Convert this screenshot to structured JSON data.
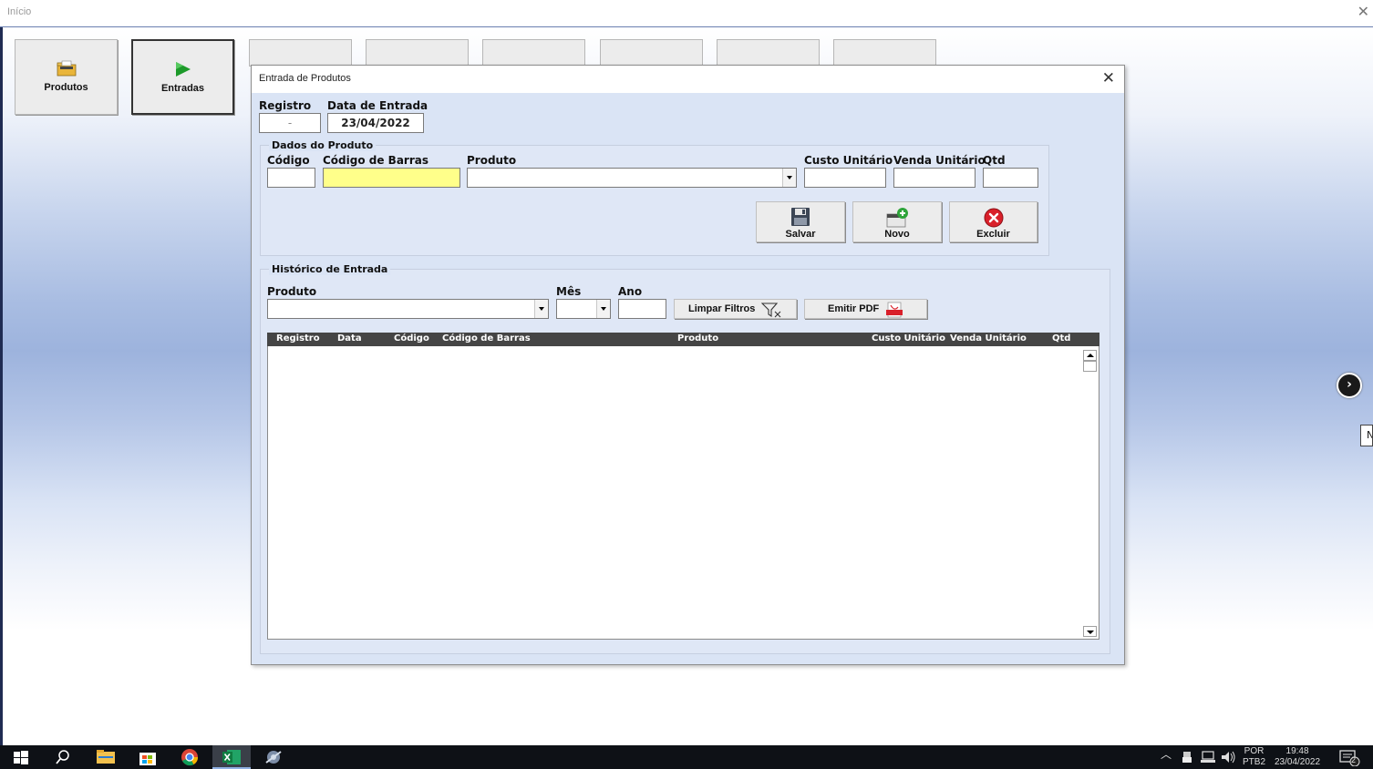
{
  "window": {
    "title": "Início",
    "close": "✕"
  },
  "nav": {
    "produtos": "Produtos",
    "entradas": "Entradas"
  },
  "dialog": {
    "title": "Entrada de Produtos",
    "close": "✕",
    "registro_label": "Registro",
    "registro_value": "-",
    "data_label": "Data de Entrada",
    "data_value": "23/04/2022",
    "dados_caption": "Dados do Produto",
    "codigo_label": "Código",
    "codigo_barras_label": "Código de Barras",
    "produto_label": "Produto",
    "custo_label": "Custo Unitário",
    "venda_label": "Venda Unitário",
    "qtd_label": "Qtd",
    "salvar": "Salvar",
    "novo": "Novo",
    "excluir": "Excluir",
    "historico_caption": "Histórico de Entrada",
    "filtro_produto_label": "Produto",
    "mes_label": "Mês",
    "ano_label": "Ano",
    "limpar": "Limpar Filtros",
    "emitir": "Emitir PDF",
    "columns": [
      "Registro",
      "Data",
      "Código",
      "Código de Barras",
      "Produto",
      "Custo Unitário",
      "Venda Unitário",
      "Qtd"
    ]
  },
  "side": {
    "next": "›",
    "tab": "N"
  },
  "tray": {
    "lang1": "POR",
    "lang2": "PTB2",
    "time": "19:48",
    "date": "23/04/2022",
    "notif": "2"
  },
  "colors": {
    "accent_yellow": "#ffff8a",
    "header_dark": "#454545",
    "dialog_bg": "#dae4f5"
  }
}
